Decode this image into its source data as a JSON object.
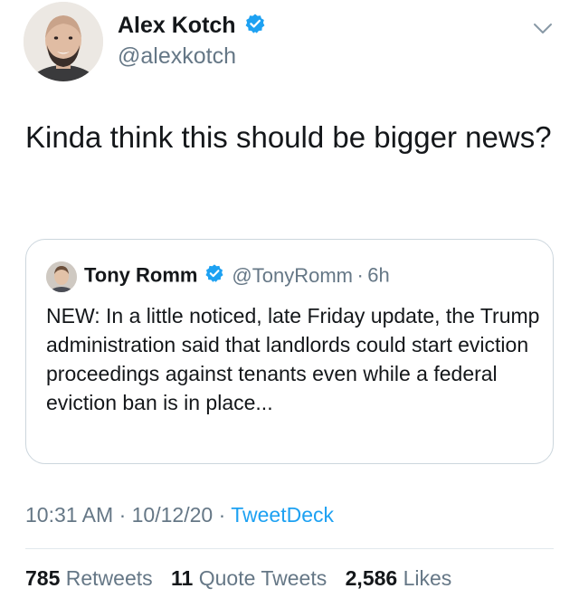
{
  "author": {
    "name": "Alex Kotch",
    "handle": "@alexkotch",
    "verified": true
  },
  "tweet": {
    "text": "Kinda think this should be bigger news?"
  },
  "quoted_tweet": {
    "name": "Tony Romm",
    "handle": "@TonyRomm",
    "separator": "·",
    "time": "6h",
    "verified": true,
    "text": "NEW: In a little noticed, late Friday update, the Trump administration said that landlords could start eviction proceedings against tenants even while a federal eviction ban is in place..."
  },
  "meta": {
    "time": "10:31 AM",
    "sep1": "·",
    "date": "10/12/20",
    "sep2": "·",
    "source": "TweetDeck"
  },
  "stats": {
    "retweets_count": "785",
    "retweets_label": "Retweets",
    "quotes_count": "11",
    "quotes_label": "Quote Tweets",
    "likes_count": "2,586",
    "likes_label": "Likes"
  },
  "colors": {
    "verified_badge": "#1da1f2",
    "link": "#1da1f2",
    "secondary_text": "#657786"
  },
  "icons": {
    "verified": "verified-badge-icon",
    "more": "chevron-down-icon"
  }
}
